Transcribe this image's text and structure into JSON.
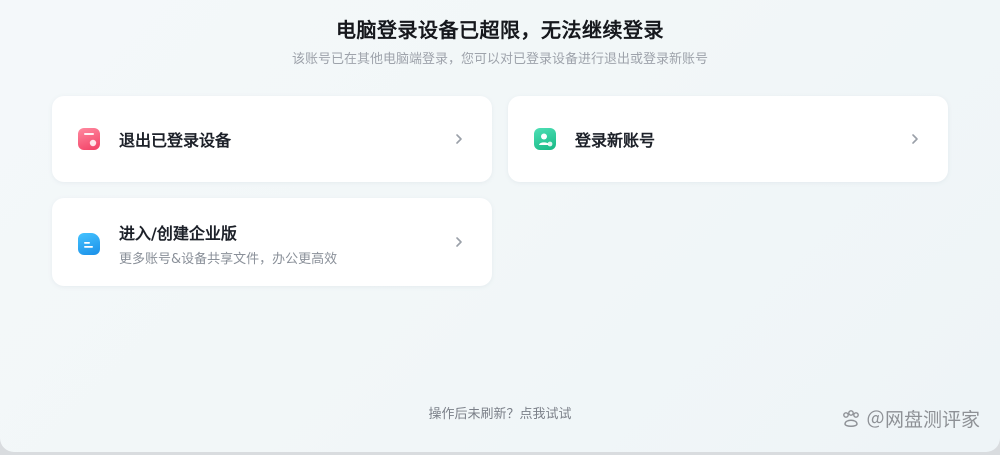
{
  "dialog": {
    "title": "电脑登录设备已超限，无法继续登录",
    "subtitle": "该账号已在其他电脑端登录，您可以对已登录设备进行退出或登录新账号"
  },
  "options": {
    "exit_devices": {
      "label": "退出已登录设备",
      "icon": "device-exit-icon",
      "color": "#f23f64"
    },
    "new_account": {
      "label": "登录新账号",
      "icon": "user-add-icon",
      "color": "#16b884"
    },
    "enterprise": {
      "label": "进入/创建企业版",
      "description": "更多账号&设备共享文件，办公更高效",
      "icon": "enterprise-folder-icon",
      "color": "#1a8fe8"
    }
  },
  "footer": {
    "refresh_text": "操作后未刷新？点我试试"
  },
  "watermark": {
    "text": "＠网盘测评家"
  }
}
